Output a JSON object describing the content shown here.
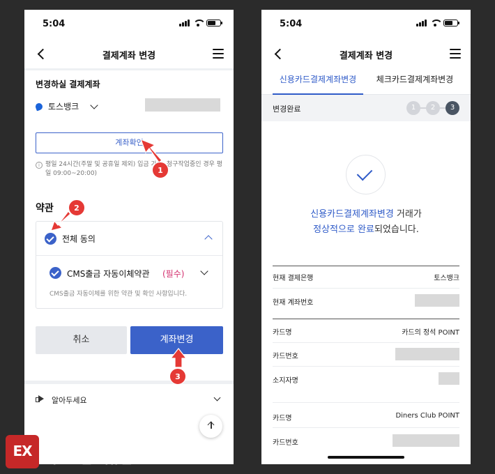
{
  "status_bar": {
    "time": "5:04"
  },
  "left_screen": {
    "title": "결제계좌 변경",
    "section_label": "변경하실 결제계좌",
    "bank_name": "토스뱅크",
    "verify_button": "계좌확인",
    "info_text": "평일 24시간(주말 및 공휴일 제외) 입금 가능, 청구작업중인 경우 평일 09:00~20:00)",
    "terms_title": "약관",
    "terms_all_label": "전체 동의",
    "terms_cms_label": "CMS출금 자동이체약관",
    "terms_cms_required": "(필수)",
    "terms_cms_desc": "CMS출금 자동이체를 위한 약관 및 확인 사항입니다.",
    "cancel_button": "취소",
    "change_button": "계좌변경",
    "notice_label": "알아두세요"
  },
  "right_screen": {
    "title": "결제계좌 변경",
    "tabs": [
      "신용카드결제계좌변경",
      "체크카드결제계좌변경"
    ],
    "step_label": "변경완료",
    "steps": [
      "1",
      "2",
      "3"
    ],
    "done_message_blue1": "신용카드결제계좌변경",
    "done_message_plain1": " 거래가",
    "done_message_blue2": "정상적으로 완료",
    "done_message_plain2": "되었습니다.",
    "rows": [
      {
        "label": "현재 결제은행",
        "value": "토스뱅크"
      },
      {
        "label": "현재 계좌번호",
        "value": ""
      },
      {
        "label": "카드명",
        "value": "카드의 정석 POINT"
      },
      {
        "label": "카드번호",
        "value": ""
      },
      {
        "label": "소지자명",
        "value": ""
      },
      {
        "label": "카드명",
        "value": "Diners Club POINT"
      },
      {
        "label": "카드번호",
        "value": ""
      }
    ]
  },
  "annotations": [
    "1",
    "2",
    "3"
  ],
  "watermark": {
    "tagline": "More Better IT Life",
    "name": "익스트림 매뉴얼"
  },
  "colors": {
    "accent": "#3b62c9",
    "required": "#d32f6e",
    "annotation": "#e53935",
    "logo": "#c62828"
  }
}
